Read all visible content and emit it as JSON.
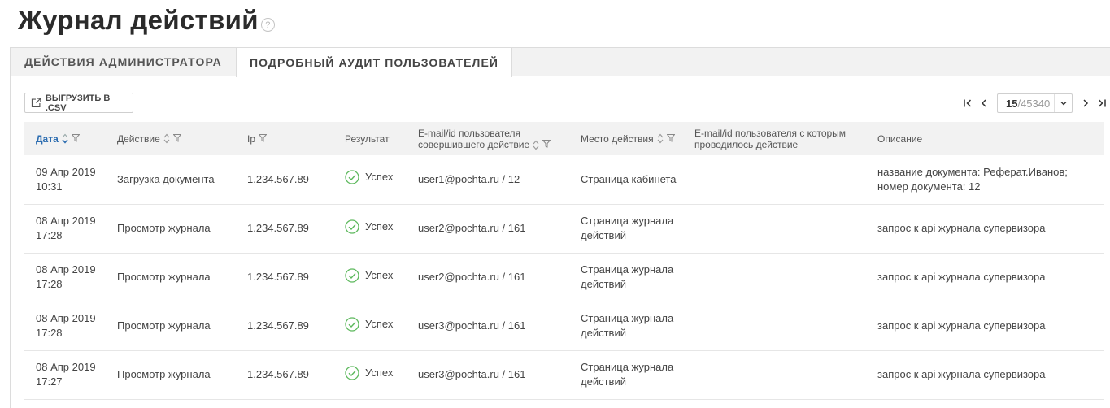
{
  "page": {
    "title": "Журнал действий",
    "help_icon": "question-circle-icon"
  },
  "tabs": [
    {
      "label": "ДЕЙСТВИЯ АДМИНИСТРАТОРА",
      "active": false
    },
    {
      "label": "ПОДРОБНЫЙ АУДИТ ПОЛЬЗОВАТЕЛЕЙ",
      "active": true
    }
  ],
  "toolbar": {
    "export_label": "ВЫГРУЗИТЬ В .CSV",
    "export_icon": "export-icon"
  },
  "pager": {
    "current": "15",
    "total": "/45340"
  },
  "columns": [
    {
      "label": "Дата"
    },
    {
      "label": "Действие"
    },
    {
      "label": "Ip"
    },
    {
      "label": "Результат"
    },
    {
      "label": "E-mail/id пользователя совершившего действие",
      "line1": "E-mail/id пользователя",
      "line2": "совершившего действие"
    },
    {
      "label": "Место действия"
    },
    {
      "label": "E-mail/id пользователя с которым проводилось действие",
      "line1": "E-mail/id пользователя с которым",
      "line2": "проводилось действие"
    },
    {
      "label": "Описание"
    }
  ],
  "rows": [
    {
      "date": "09 Апр 2019",
      "time": "10:31",
      "action": "Загрузка документа",
      "ip": "1.234.567.89",
      "result": "Успех",
      "user": "user1@pochta.ru / 12",
      "place1": "Страница кабинета",
      "place2": "",
      "target": "",
      "desc1": "название документа: Реферат.Иванов;",
      "desc2": "номер документа: 12"
    },
    {
      "date": "08 Апр 2019",
      "time": "17:28",
      "action": "Просмотр журнала",
      "ip": "1.234.567.89",
      "result": "Успех",
      "user": "user2@pochta.ru / 161",
      "place1": "Страница журнала",
      "place2": "действий",
      "target": "",
      "desc1": "запрос к api журнала супервизора",
      "desc2": ""
    },
    {
      "date": "08 Апр 2019",
      "time": "17:28",
      "action": "Просмотр журнала",
      "ip": "1.234.567.89",
      "result": "Успех",
      "user": "user2@pochta.ru / 161",
      "place1": "Страница журнала",
      "place2": "действий",
      "target": "",
      "desc1": "запрос к api журнала супервизора",
      "desc2": ""
    },
    {
      "date": "08 Апр 2019",
      "time": "17:28",
      "action": "Просмотр журнала",
      "ip": "1.234.567.89",
      "result": "Успех",
      "user": "user3@pochta.ru / 161",
      "place1": "Страница журнала",
      "place2": "действий",
      "target": "",
      "desc1": "запрос к api журнала супервизора",
      "desc2": ""
    },
    {
      "date": "08 Апр 2019",
      "time": "17:27",
      "action": "Просмотр журнала",
      "ip": "1.234.567.89",
      "result": "Успех",
      "user": "user3@pochta.ru / 161",
      "place1": "Страница журнала",
      "place2": "действий",
      "target": "",
      "desc1": "запрос к api журнала супервизора",
      "desc2": ""
    }
  ],
  "colors": {
    "accent": "#2b6cb0",
    "success": "#5cb85c",
    "header_bg": "#f2f2f2"
  }
}
